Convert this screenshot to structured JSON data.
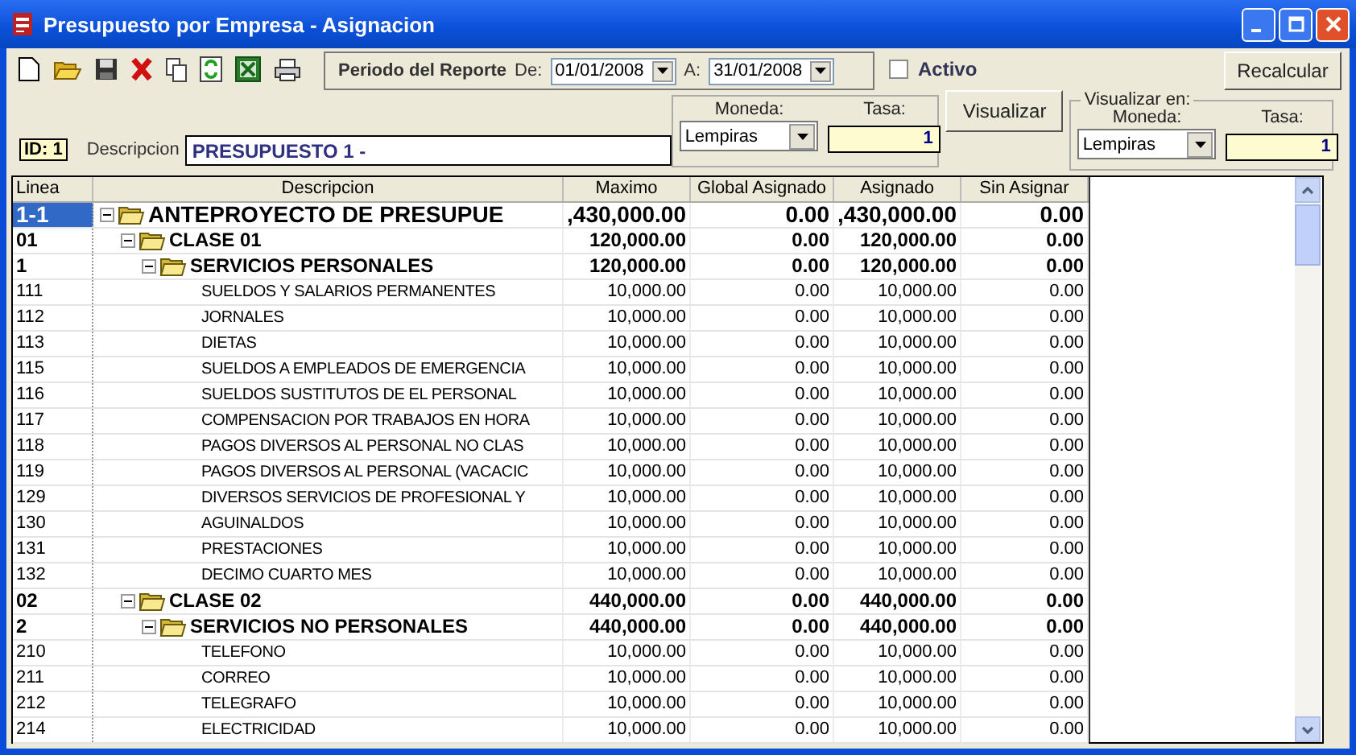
{
  "window": {
    "title": "Presupuesto por Empresa - Asignacion"
  },
  "period": {
    "label": "Periodo del Reporte",
    "from_label": "De:",
    "from": "01/01/2008",
    "to_label": "A:",
    "to": "31/01/2008"
  },
  "activo": {
    "label": "Activo",
    "checked": false
  },
  "recalcular_button": "Recalcular",
  "id_badge": "ID: 1",
  "descripcion": {
    "label": "Descripcion",
    "value": "PRESUPUESTO 1 -"
  },
  "moneda": {
    "label": "Moneda:",
    "value": "Lempiras",
    "tasa_label": "Tasa:",
    "tasa": "1"
  },
  "visualizar_button": "Visualizar",
  "visualizar_en": {
    "title": "Visualizar en:",
    "moneda_label": "Moneda:",
    "moneda": "Lempiras",
    "tasa_label": "Tasa:",
    "tasa": "1"
  },
  "table": {
    "columns": [
      "Linea",
      "Descripcion",
      "Maximo",
      "Global Asignado",
      "Asignado",
      "Sin Asignar"
    ],
    "rows": [
      {
        "linea": "1-1",
        "descripcion": "ANTEPROYECTO DE PRESUPUE",
        "maximo": ",430,000.00",
        "global": "0.00",
        "asignado": ",430,000.00",
        "sin_asignar": "0.00",
        "kind": "root",
        "selected": true,
        "expanded": true,
        "children": [
          {
            "linea": "01",
            "descripcion": "CLASE 01",
            "maximo": "120,000.00",
            "global": "0.00",
            "asignado": "120,000.00",
            "sin_asignar": "0.00",
            "kind": "group",
            "selected": false,
            "expanded": true,
            "children": [
              {
                "linea": "1",
                "descripcion": "SERVICIOS PERSONALES",
                "maximo": "120,000.00",
                "global": "0.00",
                "asignado": "120,000.00",
                "sin_asignar": "0.00",
                "kind": "group",
                "selected": false,
                "expanded": true,
                "children": [
                  {
                    "linea": "111",
                    "descripcion": "SUELDOS Y SALARIOS PERMANENTES",
                    "maximo": "10,000.00",
                    "global": "0.00",
                    "asignado": "10,000.00",
                    "sin_asignar": "0.00",
                    "kind": "item",
                    "selected": false
                  },
                  {
                    "linea": "112",
                    "descripcion": "JORNALES",
                    "maximo": "10,000.00",
                    "global": "0.00",
                    "asignado": "10,000.00",
                    "sin_asignar": "0.00",
                    "kind": "item",
                    "selected": false
                  },
                  {
                    "linea": "113",
                    "descripcion": "DIETAS",
                    "maximo": "10,000.00",
                    "global": "0.00",
                    "asignado": "10,000.00",
                    "sin_asignar": "0.00",
                    "kind": "item",
                    "selected": false
                  },
                  {
                    "linea": "115",
                    "descripcion": "SUELDOS A EMPLEADOS DE EMERGENCIA",
                    "maximo": "10,000.00",
                    "global": "0.00",
                    "asignado": "10,000.00",
                    "sin_asignar": "0.00",
                    "kind": "item",
                    "selected": false
                  },
                  {
                    "linea": "116",
                    "descripcion": "SUELDOS SUSTITUTOS DE EL PERSONAL",
                    "maximo": "10,000.00",
                    "global": "0.00",
                    "asignado": "10,000.00",
                    "sin_asignar": "0.00",
                    "kind": "item",
                    "selected": false
                  },
                  {
                    "linea": "117",
                    "descripcion": "COMPENSACION POR TRABAJOS EN HORA",
                    "maximo": "10,000.00",
                    "global": "0.00",
                    "asignado": "10,000.00",
                    "sin_asignar": "0.00",
                    "kind": "item",
                    "selected": false
                  },
                  {
                    "linea": "118",
                    "descripcion": "PAGOS DIVERSOS AL PERSONAL NO CLAS",
                    "maximo": "10,000.00",
                    "global": "0.00",
                    "asignado": "10,000.00",
                    "sin_asignar": "0.00",
                    "kind": "item",
                    "selected": false
                  },
                  {
                    "linea": "119",
                    "descripcion": "PAGOS DIVERSOS AL PERSONAL (VACACIC",
                    "maximo": "10,000.00",
                    "global": "0.00",
                    "asignado": "10,000.00",
                    "sin_asignar": "0.00",
                    "kind": "item",
                    "selected": false
                  },
                  {
                    "linea": "129",
                    "descripcion": "DIVERSOS SERVICIOS DE PROFESIONAL Y",
                    "maximo": "10,000.00",
                    "global": "0.00",
                    "asignado": "10,000.00",
                    "sin_asignar": "0.00",
                    "kind": "item",
                    "selected": false
                  },
                  {
                    "linea": "130",
                    "descripcion": "AGUINALDOS",
                    "maximo": "10,000.00",
                    "global": "0.00",
                    "asignado": "10,000.00",
                    "sin_asignar": "0.00",
                    "kind": "item",
                    "selected": false
                  },
                  {
                    "linea": "131",
                    "descripcion": "PRESTACIONES",
                    "maximo": "10,000.00",
                    "global": "0.00",
                    "asignado": "10,000.00",
                    "sin_asignar": "0.00",
                    "kind": "item",
                    "selected": false
                  },
                  {
                    "linea": "132",
                    "descripcion": "DECIMO CUARTO MES",
                    "maximo": "10,000.00",
                    "global": "0.00",
                    "asignado": "10,000.00",
                    "sin_asignar": "0.00",
                    "kind": "item",
                    "selected": false
                  }
                ]
              }
            ]
          },
          {
            "linea": "02",
            "descripcion": "CLASE 02",
            "maximo": "440,000.00",
            "global": "0.00",
            "asignado": "440,000.00",
            "sin_asignar": "0.00",
            "kind": "group",
            "selected": false,
            "expanded": true,
            "children": [
              {
                "linea": "2",
                "descripcion": "SERVICIOS NO PERSONALES",
                "maximo": "440,000.00",
                "global": "0.00",
                "asignado": "440,000.00",
                "sin_asignar": "0.00",
                "kind": "group",
                "selected": false,
                "expanded": true,
                "children": [
                  {
                    "linea": "210",
                    "descripcion": "TELEFONO",
                    "maximo": "10,000.00",
                    "global": "0.00",
                    "asignado": "10,000.00",
                    "sin_asignar": "0.00",
                    "kind": "item",
                    "selected": false
                  },
                  {
                    "linea": "211",
                    "descripcion": "CORREO",
                    "maximo": "10,000.00",
                    "global": "0.00",
                    "asignado": "10,000.00",
                    "sin_asignar": "0.00",
                    "kind": "item",
                    "selected": false
                  },
                  {
                    "linea": "212",
                    "descripcion": "TELEGRAFO",
                    "maximo": "10,000.00",
                    "global": "0.00",
                    "asignado": "10,000.00",
                    "sin_asignar": "0.00",
                    "kind": "item",
                    "selected": false
                  },
                  {
                    "linea": "214",
                    "descripcion": "ELECTRICIDAD",
                    "maximo": "10,000.00",
                    "global": "0.00",
                    "asignado": "10,000.00",
                    "sin_asignar": "0.00",
                    "kind": "item",
                    "selected": false
                  }
                ]
              }
            ]
          }
        ]
      }
    ]
  }
}
